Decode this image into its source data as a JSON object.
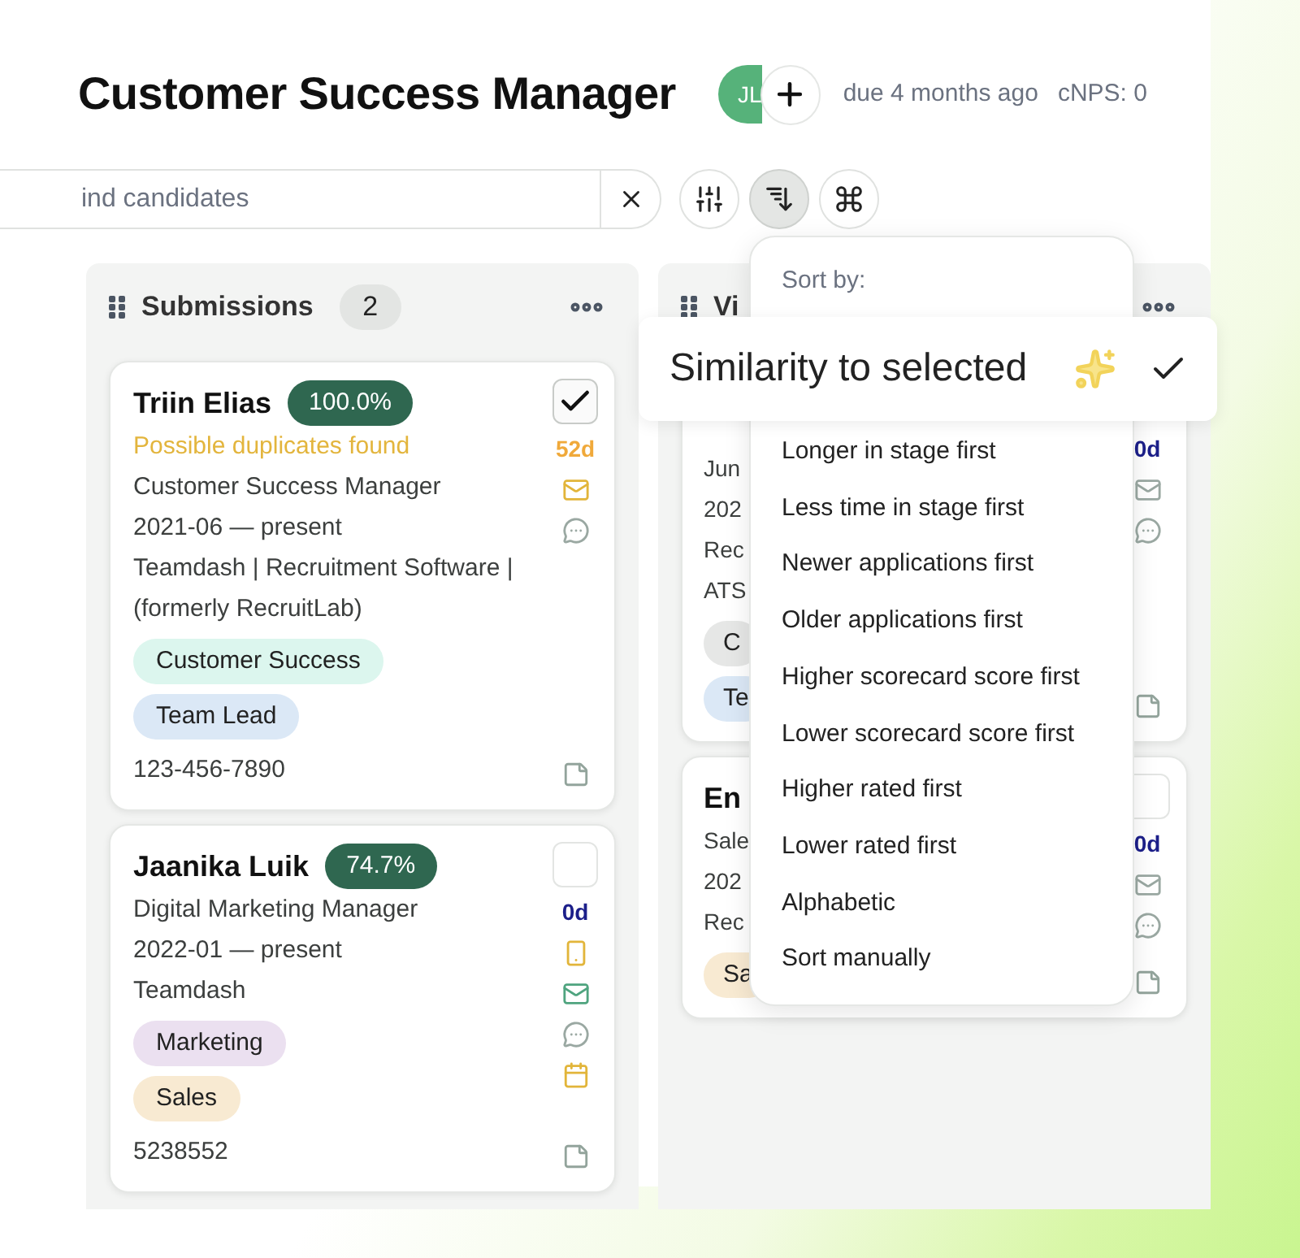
{
  "header": {
    "title": "Customer Success Manager",
    "avatar_initials": "JL",
    "due": "due 4 months ago",
    "cnps": "cNPS: 0"
  },
  "toolbar": {
    "search": {
      "placeholder": "ind candidates"
    },
    "buttons": [
      {
        "kind": "filter",
        "selected": false
      },
      {
        "kind": "sort",
        "selected": true
      },
      {
        "kind": "command",
        "selected": false
      }
    ]
  },
  "columns": [
    {
      "title": "Submissions",
      "count": "2",
      "cards": [
        {
          "name": "Triin Elias",
          "score": "100.0%",
          "checked": true,
          "warning": "Possible duplicates found",
          "days": "52d",
          "overdue": true,
          "lines": [
            "Customer Success Manager",
            "2021-06 — present",
            "Teamdash | Recruitment Software |",
            "(formerly RecruitLab)"
          ],
          "tags": [
            {
              "label": "Customer Success",
              "color": "#dcf6ee"
            },
            {
              "label": "Team Lead",
              "color": "#dbe8f6"
            }
          ],
          "phone": "123-456-7890",
          "icons": [
            {
              "kind": "mail",
              "color": "#e2b53a"
            },
            {
              "kind": "chat",
              "color": "#9aa8a2"
            }
          ]
        },
        {
          "name": "Jaanika Luik",
          "score": "74.7%",
          "checked": false,
          "days": "0d",
          "overdue": false,
          "lines": [
            "Digital Marketing Manager",
            "2022-01 — present",
            "Teamdash"
          ],
          "tags": [
            {
              "label": "Marketing",
              "color": "#ebe0f0"
            },
            {
              "label": "Sales",
              "color": "#f8ead2"
            }
          ],
          "phone": "5238552",
          "icons": [
            {
              "kind": "phone",
              "color": "#e2b53a"
            },
            {
              "kind": "mail",
              "color": "#4fa47f"
            },
            {
              "kind": "chat",
              "color": "#9aa8a2"
            },
            {
              "kind": "calendar",
              "color": "#e2b53a"
            }
          ]
        }
      ]
    },
    {
      "title": "Vi",
      "cards": [
        {
          "days": "0d",
          "overdue": false,
          "lines": [
            "Jun",
            "202",
            "Rec",
            "ATS"
          ],
          "tags": [
            {
              "label": "C",
              "color": "#e6e7e6"
            },
            {
              "label": "Te",
              "color": "#dbe8f6"
            }
          ],
          "icons": [
            {
              "kind": "mail",
              "color": "#9aa8a2"
            },
            {
              "kind": "chat",
              "color": "#9aa8a2"
            }
          ]
        },
        {
          "name": "En",
          "checked": false,
          "days": "0d",
          "overdue": false,
          "lines": [
            "Sale",
            "202",
            "Rec"
          ],
          "tags": [
            {
              "label": "Sa",
              "color": "#f8ead2"
            }
          ],
          "icons": [
            {
              "kind": "mail",
              "color": "#9aa8a2"
            },
            {
              "kind": "chat",
              "color": "#9aa8a2"
            }
          ]
        }
      ]
    }
  ],
  "sort_menu": {
    "heading": "Sort by:",
    "options": [
      {
        "label": "Similarity to selected",
        "ai": true,
        "selected": true
      },
      {
        "label": "Longer in stage first",
        "selected": false
      },
      {
        "label": "Less time in stage first",
        "selected": false
      },
      {
        "label": "Newer applications first",
        "selected": false
      },
      {
        "label": "Older applications first",
        "selected": false
      },
      {
        "label": "Higher scorecard score first",
        "selected": false
      },
      {
        "label": "Lower scorecard score first",
        "selected": false
      },
      {
        "label": "Higher rated first",
        "selected": false
      },
      {
        "label": "Lower rated first",
        "selected": false
      },
      {
        "label": "Alphabetic",
        "selected": false
      },
      {
        "label": "Sort manually",
        "selected": false
      }
    ]
  }
}
